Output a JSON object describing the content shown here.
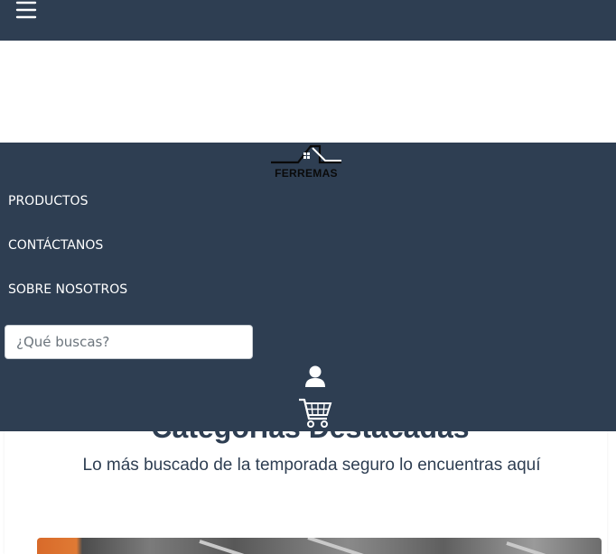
{
  "header": {
    "menu_icon": "hamburger-menu-icon"
  },
  "brand": {
    "name": "FERREMAS",
    "logo_icon": "house-roof-logo-icon"
  },
  "nav": {
    "items": [
      {
        "label": "PRODUCTOS"
      },
      {
        "label": "CONTÁCTANOS"
      },
      {
        "label": "SOBRE NOSOTROS"
      }
    ]
  },
  "search": {
    "placeholder": "¿Qué buscas?",
    "value": ""
  },
  "actions": {
    "user_icon": "user-icon",
    "cart_icon": "shopping-cart-icon"
  },
  "featured": {
    "title": "Categorías Destacadas",
    "subtitle": "Lo más buscado de la temporada seguro lo encuentras aquí"
  },
  "colors": {
    "navy": "#2e3e52",
    "white": "#ffffff"
  }
}
